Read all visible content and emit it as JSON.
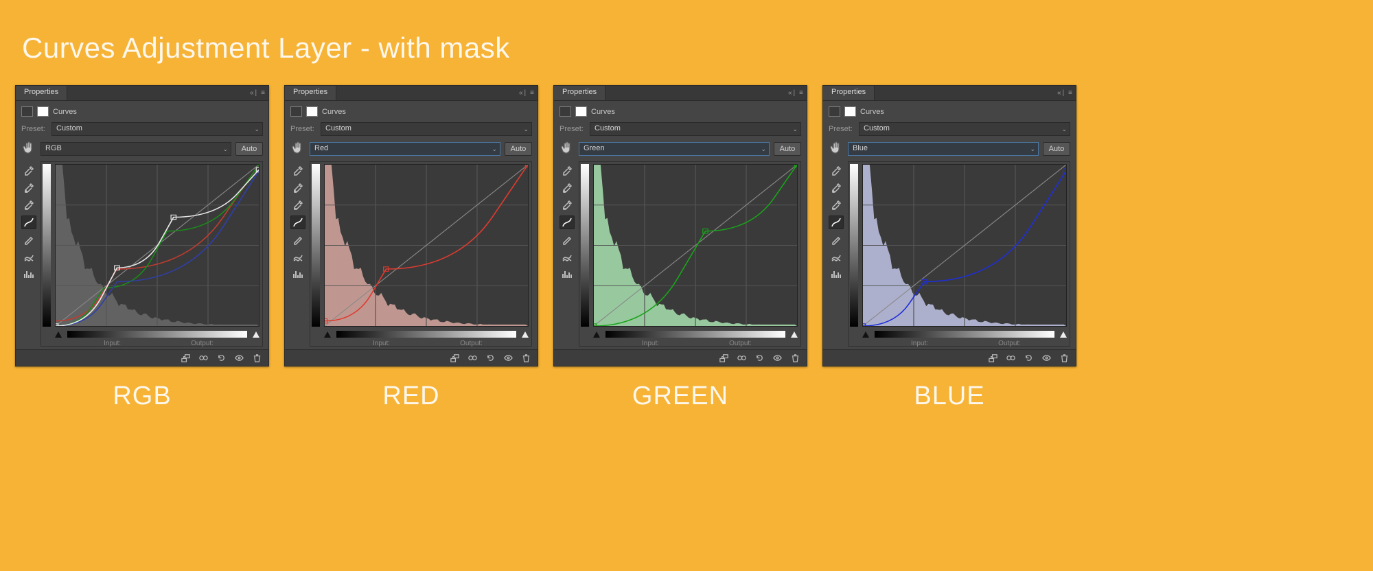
{
  "page": {
    "title": "Curves Adjustment Layer - with mask"
  },
  "common": {
    "panel_tab": "Properties",
    "adjustment_title": "Curves",
    "preset_label": "Preset:",
    "preset_value": "Custom",
    "auto_label": "Auto",
    "input_label": "Input:",
    "output_label": "Output:"
  },
  "panels": [
    {
      "channel": "RGB",
      "label": "RGB",
      "channel_highlight": false,
      "hist_color": "#6a6a6a",
      "curve_color": "#e8e8e8",
      "pt_color": "#e8e8e8"
    },
    {
      "channel": "Red",
      "label": "RED",
      "channel_highlight": true,
      "hist_color": "#d8a8a0",
      "curve_color": "#de3b2f",
      "pt_color": "#de3b2f"
    },
    {
      "channel": "Green",
      "label": "GREEN",
      "channel_highlight": true,
      "hist_color": "#a9e3b0",
      "curve_color": "#1aa21a",
      "pt_color": "#1aa21a"
    },
    {
      "channel": "Blue",
      "label": "BLUE",
      "channel_highlight": true,
      "hist_color": "#c2c6e8",
      "curve_color": "#1f2fd6",
      "pt_color": "#1f2fd6"
    }
  ],
  "chart_data": [
    {
      "type": "line",
      "title": "RGB curve",
      "xlabel": "Input",
      "ylabel": "Output",
      "xlim": [
        0,
        255
      ],
      "ylim": [
        0,
        255
      ],
      "overlay_curves": [
        {
          "name": "red",
          "color": "#c23b2f",
          "points": [
            [
              0,
              8
            ],
            [
              77,
              90
            ],
            [
              255,
              255
            ]
          ]
        },
        {
          "name": "green",
          "color": "#1a8a1a",
          "points": [
            [
              0,
              0
            ],
            [
              60,
              60
            ],
            [
              140,
              150
            ],
            [
              255,
              255
            ]
          ]
        },
        {
          "name": "blue",
          "color": "#2f3fa8",
          "points": [
            [
              0,
              0
            ],
            [
              77,
              70
            ],
            [
              255,
              245
            ]
          ]
        }
      ],
      "series": [
        {
          "name": "RGB",
          "color": "#e8e8e8",
          "points": [
            [
              0,
              0
            ],
            [
              77,
              92
            ],
            [
              148,
              172
            ],
            [
              255,
              247
            ]
          ]
        }
      ],
      "histogram": {
        "color": "#6a6a6a",
        "shape": "left-heavy-decay"
      }
    },
    {
      "type": "line",
      "title": "Red curve",
      "xlabel": "Input",
      "ylabel": "Output",
      "xlim": [
        0,
        255
      ],
      "ylim": [
        0,
        255
      ],
      "series": [
        {
          "name": "Red",
          "color": "#de3b2f",
          "points": [
            [
              0,
              8
            ],
            [
              77,
              90
            ],
            [
              255,
              255
            ]
          ]
        }
      ],
      "histogram": {
        "color": "#d8a8a0",
        "shape": "left-heavy-decay"
      }
    },
    {
      "type": "line",
      "title": "Green curve",
      "xlabel": "Input",
      "ylabel": "Output",
      "xlim": [
        0,
        255
      ],
      "ylim": [
        0,
        255
      ],
      "series": [
        {
          "name": "Green",
          "color": "#1aa21a",
          "points": [
            [
              0,
              0
            ],
            [
              140,
              150
            ],
            [
              255,
              255
            ]
          ]
        }
      ],
      "histogram": {
        "color": "#a9e3b0",
        "shape": "left-heavy-decay"
      }
    },
    {
      "type": "line",
      "title": "Blue curve",
      "xlabel": "Input",
      "ylabel": "Output",
      "xlim": [
        0,
        255
      ],
      "ylim": [
        0,
        255
      ],
      "series": [
        {
          "name": "Blue",
          "color": "#1f2fd6",
          "points": [
            [
              0,
              0
            ],
            [
              77,
              70
            ],
            [
              255,
              245
            ]
          ]
        }
      ],
      "histogram": {
        "color": "#c2c6e8",
        "shape": "left-heavy-decay"
      }
    }
  ]
}
